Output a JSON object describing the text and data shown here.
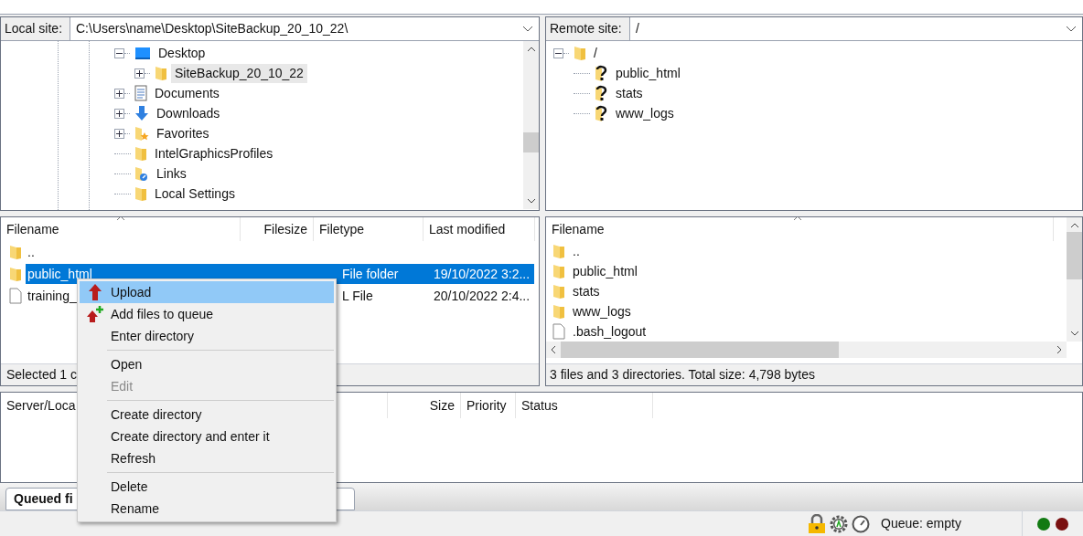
{
  "local_site": {
    "label": "Local site:",
    "path": "C:\\Users\\name\\Desktop\\SiteBackup_20_10_22\\"
  },
  "local_tree": [
    {
      "label": "Desktop",
      "kind": "desktop",
      "expanded": true,
      "selected": false,
      "children": [
        {
          "label": "SiteBackup_20_10_22",
          "kind": "folder",
          "expanded": false,
          "selected": true
        }
      ]
    },
    {
      "label": "Documents",
      "kind": "documents",
      "expanded": false,
      "selected": false
    },
    {
      "label": "Downloads",
      "kind": "download",
      "expanded": false,
      "selected": false
    },
    {
      "label": "Favorites",
      "kind": "favorites",
      "expanded": false,
      "selected": false
    },
    {
      "label": "IntelGraphicsProfiles",
      "kind": "folder",
      "selected": false
    },
    {
      "label": "Links",
      "kind": "links",
      "selected": false
    },
    {
      "label": "Local Settings",
      "kind": "folder",
      "selected": false
    }
  ],
  "remote_site": {
    "label": "Remote site:",
    "path": "/"
  },
  "remote_tree": [
    {
      "label": "/",
      "kind": "folder",
      "expanded": true,
      "selected": false,
      "children": [
        {
          "label": "public_html",
          "kind": "unknown",
          "selected": false
        },
        {
          "label": "stats",
          "kind": "unknown",
          "selected": false
        },
        {
          "label": "www_logs",
          "kind": "unknown",
          "selected": false
        }
      ]
    }
  ],
  "local_list": {
    "columns": [
      "Filename",
      "Filesize",
      "Filetype",
      "Last modified"
    ],
    "rows": [
      {
        "kind": "folder",
        "name": "..",
        "selected": false
      },
      {
        "kind": "folder",
        "name": "public_html",
        "type": "File folder",
        "modified": "19/10/2022 3:2...",
        "selected": true
      },
      {
        "kind": "file",
        "name": "training_",
        "type": "L File",
        "modified": "20/10/2022 2:4...",
        "selected": false
      }
    ],
    "status": "Selected 1 c"
  },
  "remote_list": {
    "columns": [
      "Filename"
    ],
    "rows": [
      {
        "kind": "folder",
        "name": ".."
      },
      {
        "kind": "folder",
        "name": "public_html"
      },
      {
        "kind": "folder",
        "name": "stats"
      },
      {
        "kind": "folder",
        "name": "www_logs"
      },
      {
        "kind": "file",
        "name": ".bash_logout"
      }
    ],
    "status": "3 files and 3 directories. Total size: 4,798 bytes"
  },
  "queue": {
    "columns": [
      "Server/Loca",
      "Size",
      "Priority",
      "Status"
    ]
  },
  "tabs": [
    {
      "label": "Queued fi",
      "selected": true
    }
  ],
  "status_bar": {
    "queue": "Queue: empty"
  },
  "context_menu": [
    {
      "kind": "item",
      "label": "Upload",
      "selected": true,
      "disabled": false
    },
    {
      "kind": "item",
      "label": "Add files to queue",
      "selected": false,
      "disabled": false
    },
    {
      "kind": "item",
      "label": "Enter directory",
      "selected": false,
      "disabled": false
    },
    {
      "kind": "separator"
    },
    {
      "kind": "item",
      "label": "Open",
      "selected": false,
      "disabled": false
    },
    {
      "kind": "item",
      "label": "Edit",
      "selected": false,
      "disabled": true
    },
    {
      "kind": "separator"
    },
    {
      "kind": "item",
      "label": "Create directory",
      "selected": false,
      "disabled": false
    },
    {
      "kind": "item",
      "label": "Create directory and enter it",
      "selected": false,
      "disabled": false
    },
    {
      "kind": "item",
      "label": "Refresh",
      "selected": false,
      "disabled": false
    },
    {
      "kind": "separator"
    },
    {
      "kind": "item",
      "label": "Delete",
      "selected": false,
      "disabled": false
    },
    {
      "kind": "item",
      "label": "Rename",
      "selected": false,
      "disabled": false
    }
  ]
}
